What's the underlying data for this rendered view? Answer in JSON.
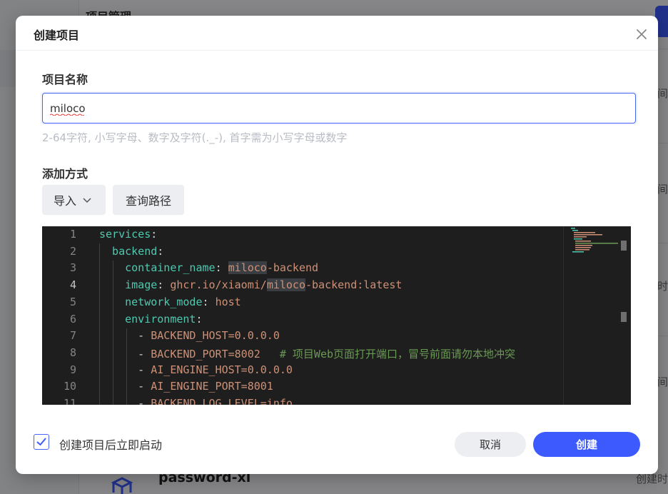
{
  "background": {
    "page_title": "项目管理",
    "card_time_labels": [
      "时间",
      "时间",
      "时",
      "时间",
      "时间"
    ],
    "bottom_card_name": "password-xl",
    "bottom_card_time": "创建时"
  },
  "modal": {
    "title": "创建项目",
    "close_icon": "close-icon",
    "project_name_label": "项目名称",
    "project_name_value": "miloco",
    "project_name_hint": "2-64字符, 小写字母、数字及字符(._-), 首字需为小写字母或数字",
    "add_method_label": "添加方式",
    "import_button": "导入",
    "query_path_button": "查询路径",
    "editor": {
      "line_numbers": [
        "1",
        "2",
        "3",
        "4",
        "5",
        "6",
        "7",
        "8",
        "9",
        "10",
        "11"
      ],
      "active_line": "4",
      "lines": [
        [
          {
            "t": "services",
            "c": "k"
          },
          {
            "t": ":",
            "c": "p"
          }
        ],
        [
          {
            "t": "  backend",
            "c": "k"
          },
          {
            "t": ":",
            "c": "p"
          }
        ],
        [
          {
            "t": "    container_name",
            "c": "k"
          },
          {
            "t": ": ",
            "c": "p"
          },
          {
            "t": "miloco",
            "c": "v hl"
          },
          {
            "t": "-backend",
            "c": "v"
          }
        ],
        [
          {
            "t": "    image",
            "c": "k"
          },
          {
            "t": ": ",
            "c": "p"
          },
          {
            "t": "ghcr.io/xiaomi/",
            "c": "v"
          },
          {
            "t": "miloco",
            "c": "v hl"
          },
          {
            "t": "-backend:latest",
            "c": "v"
          }
        ],
        [
          {
            "t": "    network_mode",
            "c": "k"
          },
          {
            "t": ": ",
            "c": "p"
          },
          {
            "t": "host",
            "c": "v"
          }
        ],
        [
          {
            "t": "    environment",
            "c": "k"
          },
          {
            "t": ":",
            "c": "p"
          }
        ],
        [
          {
            "t": "      - ",
            "c": "p"
          },
          {
            "t": "BACKEND_HOST=0.0.0.0",
            "c": "v"
          }
        ],
        [
          {
            "t": "      - ",
            "c": "p"
          },
          {
            "t": "BACKEND_PORT=8002",
            "c": "v"
          },
          {
            "t": "   # 项目Web页面打开端口，冒号前面请勿本地冲突",
            "c": "c"
          }
        ],
        [
          {
            "t": "      - ",
            "c": "p"
          },
          {
            "t": "AI_ENGINE_HOST=0.0.0.0",
            "c": "v"
          }
        ],
        [
          {
            "t": "      - ",
            "c": "p"
          },
          {
            "t": "AI_ENGINE_PORT=8001",
            "c": "v"
          }
        ],
        [
          {
            "t": "      - ",
            "c": "p"
          },
          {
            "t": "BACKEND_LOG_LEVEL=info",
            "c": "v"
          }
        ]
      ]
    },
    "start_after_create_label": "创建项目后立即启动",
    "start_after_create_checked": true,
    "cancel_button": "取消",
    "create_button": "创建",
    "accent_color": "#3d5afe"
  }
}
